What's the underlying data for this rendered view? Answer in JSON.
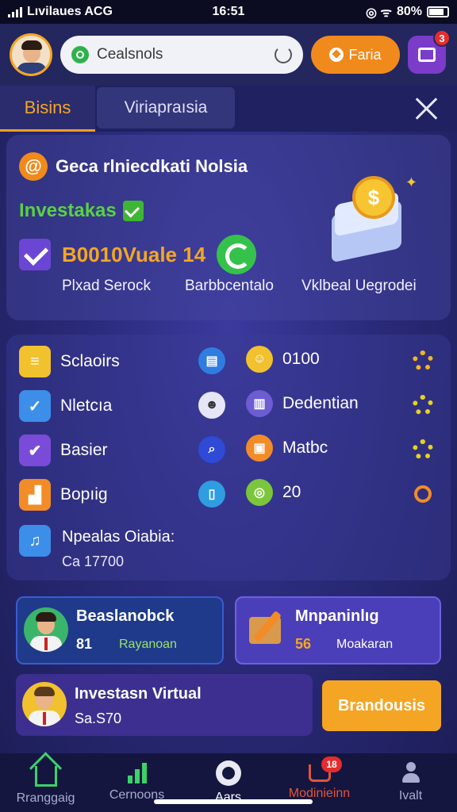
{
  "status_bar": {
    "carrier": "Lıvilaues ACG",
    "time": "16:51",
    "battery": "80%"
  },
  "header": {
    "search_text": "Cealsnols",
    "premium_label": "Faria",
    "notification_count": "3"
  },
  "tabs": {
    "active": "Bisins",
    "inactive": "Viriapraısia"
  },
  "hero": {
    "title": "Geca rlniecdkati Nolsia",
    "investakas": "Investakas",
    "amount": "B0010Vuale 14",
    "labels": [
      "Plxad Serock",
      "Barbbcentalo",
      "Vklbeal Uegrodei"
    ]
  },
  "menu": {
    "left": [
      {
        "label": "Sclaoirs",
        "icon": "document-icon",
        "color": "#f2c12e"
      },
      {
        "label": "Nletcıa",
        "icon": "check-icon",
        "color": "#3c8ee8"
      },
      {
        "label": "Basier",
        "icon": "checklist-icon",
        "color": "#7a4bd8"
      },
      {
        "label": "Bopıig",
        "icon": "chart-icon",
        "color": "#f28c28"
      }
    ],
    "right": [
      {
        "label": "0100",
        "icon": "emoji-icon"
      },
      {
        "label": "Dedentian",
        "icon": "bars-icon"
      },
      {
        "label": "Matbc",
        "icon": "box-icon"
      },
      {
        "label": "20",
        "icon": "coin-icon"
      }
    ],
    "footer_label": "Npealas Oiabia:",
    "footer_value": "Ca 17700"
  },
  "cards": {
    "card1_title": "Beaslanobck",
    "card1_value": "81",
    "card1_sub": "Rayanoan",
    "card2_title": "Mnpaninlıg",
    "card2_value": "56",
    "card2_sub": "Moakaran",
    "card3_title": "Investasn Virtual",
    "card3_value": "Sa.S70",
    "cta_label": "Brandousis"
  },
  "nav": {
    "items": [
      "Rranggaig",
      "Cernoons",
      "Aars",
      "Modinieinn",
      "Ivalt"
    ],
    "cart_badge": "18"
  },
  "colors": {
    "accent_orange": "#f5a623",
    "accent_green": "#3bd26a",
    "background": "#2a2a7a"
  }
}
